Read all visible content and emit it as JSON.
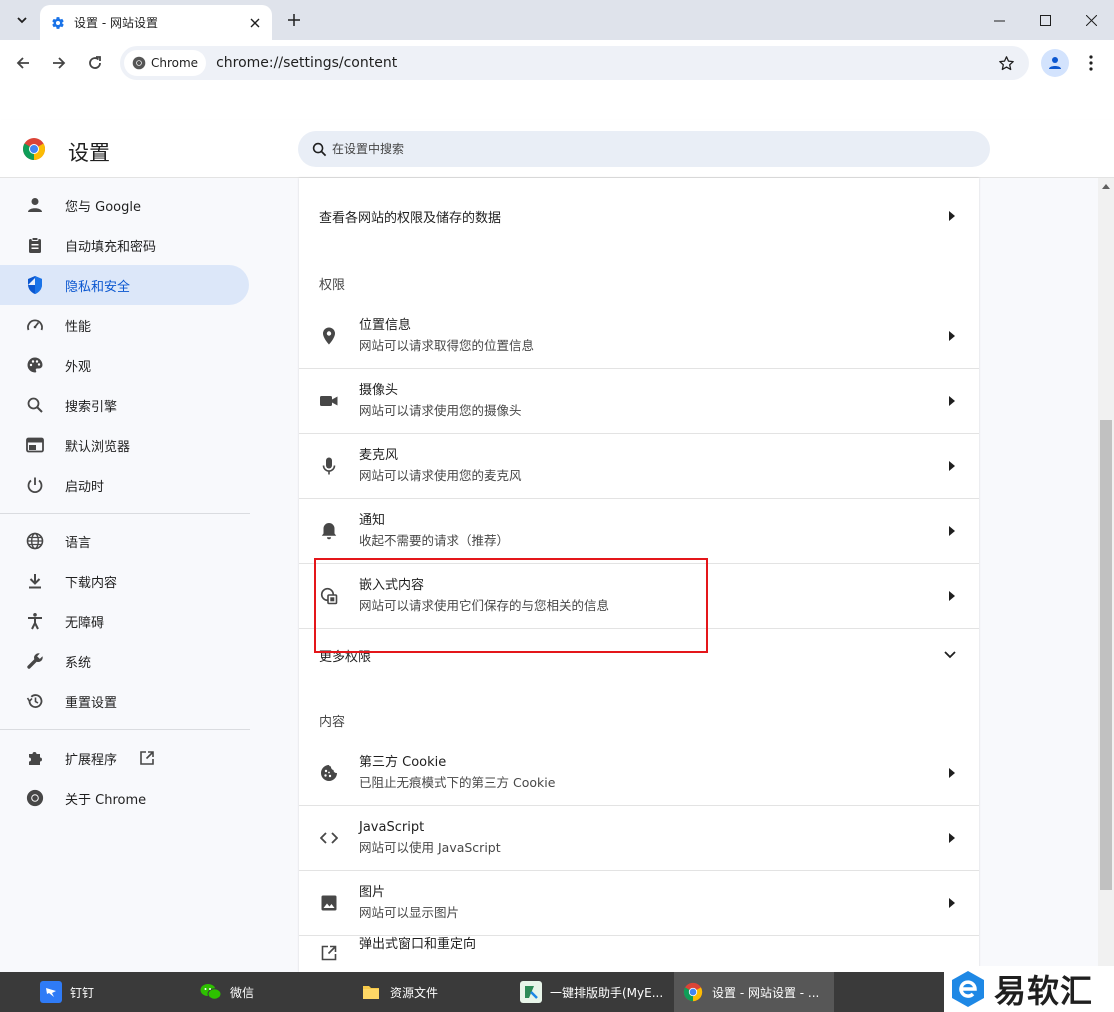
{
  "browser": {
    "tab_title": "设置 - 网站设置",
    "chip_label": "Chrome",
    "url": "chrome://settings/content"
  },
  "header": {
    "title": "设置",
    "search_placeholder": "在设置中搜索"
  },
  "sidebar": {
    "items": [
      {
        "label": "您与 Google",
        "icon": "person-icon"
      },
      {
        "label": "自动填充和密码",
        "icon": "clipboard-icon"
      },
      {
        "label": "隐私和安全",
        "icon": "shield-icon",
        "active": true
      },
      {
        "label": "性能",
        "icon": "speedometer-icon"
      },
      {
        "label": "外观",
        "icon": "palette-icon"
      },
      {
        "label": "搜索引擎",
        "icon": "search-icon"
      },
      {
        "label": "默认浏览器",
        "icon": "browser-window-icon"
      },
      {
        "label": "启动时",
        "icon": "power-icon"
      },
      {
        "label": "语言",
        "icon": "globe-icon"
      },
      {
        "label": "下载内容",
        "icon": "download-icon"
      },
      {
        "label": "无障碍",
        "icon": "accessibility-icon"
      },
      {
        "label": "系统",
        "icon": "wrench-icon"
      },
      {
        "label": "重置设置",
        "icon": "history-icon"
      },
      {
        "label": "扩展程序",
        "icon": "puzzle-icon"
      },
      {
        "label": "关于 Chrome",
        "icon": "chrome-icon"
      }
    ]
  },
  "main": {
    "site_data_row": "查看各网站的权限及储存的数据",
    "permissions_label": "权限",
    "permissions": [
      {
        "title": "位置信息",
        "subtitle": "网站可以请求取得您的位置信息",
        "icon": "location-pin-icon"
      },
      {
        "title": "摄像头",
        "subtitle": "网站可以请求使用您的摄像头",
        "icon": "camera-icon"
      },
      {
        "title": "麦克风",
        "subtitle": "网站可以请求使用您的麦克风",
        "icon": "microphone-icon"
      },
      {
        "title": "通知",
        "subtitle": "收起不需要的请求（推荐）",
        "icon": "bell-icon"
      },
      {
        "title": "嵌入式内容",
        "subtitle": "网站可以请求使用它们保存的与您相关的信息",
        "icon": "embedded-content-icon"
      }
    ],
    "more_permissions": "更多权限",
    "content_label": "内容",
    "content": [
      {
        "title": "第三方 Cookie",
        "subtitle": "已阻止无痕模式下的第三方 Cookie",
        "icon": "cookie-icon"
      },
      {
        "title": "JavaScript",
        "subtitle": "网站可以使用 JavaScript",
        "icon": "code-icon"
      },
      {
        "title": "图片",
        "subtitle": "网站可以显示图片",
        "icon": "image-icon"
      },
      {
        "title": "弹出式窗口和重定向",
        "subtitle": "",
        "icon": "open-in-new-icon"
      }
    ]
  },
  "taskbar": {
    "items": [
      {
        "label": "钉钉",
        "icon": "dingtalk-icon"
      },
      {
        "label": "微信",
        "icon": "wechat-icon"
      },
      {
        "label": "资源文件",
        "icon": "folder-icon"
      },
      {
        "label": "一键排版助手(MyE...",
        "icon": "myeditor-icon"
      },
      {
        "label": "设置 - 网站设置 - ...",
        "icon": "chrome-icon",
        "active": true
      }
    ],
    "watermark": "易软汇"
  },
  "colors": {
    "accent": "#0b57d0",
    "active_bg": "#dce7f9",
    "highlight_border": "#e4161a"
  }
}
